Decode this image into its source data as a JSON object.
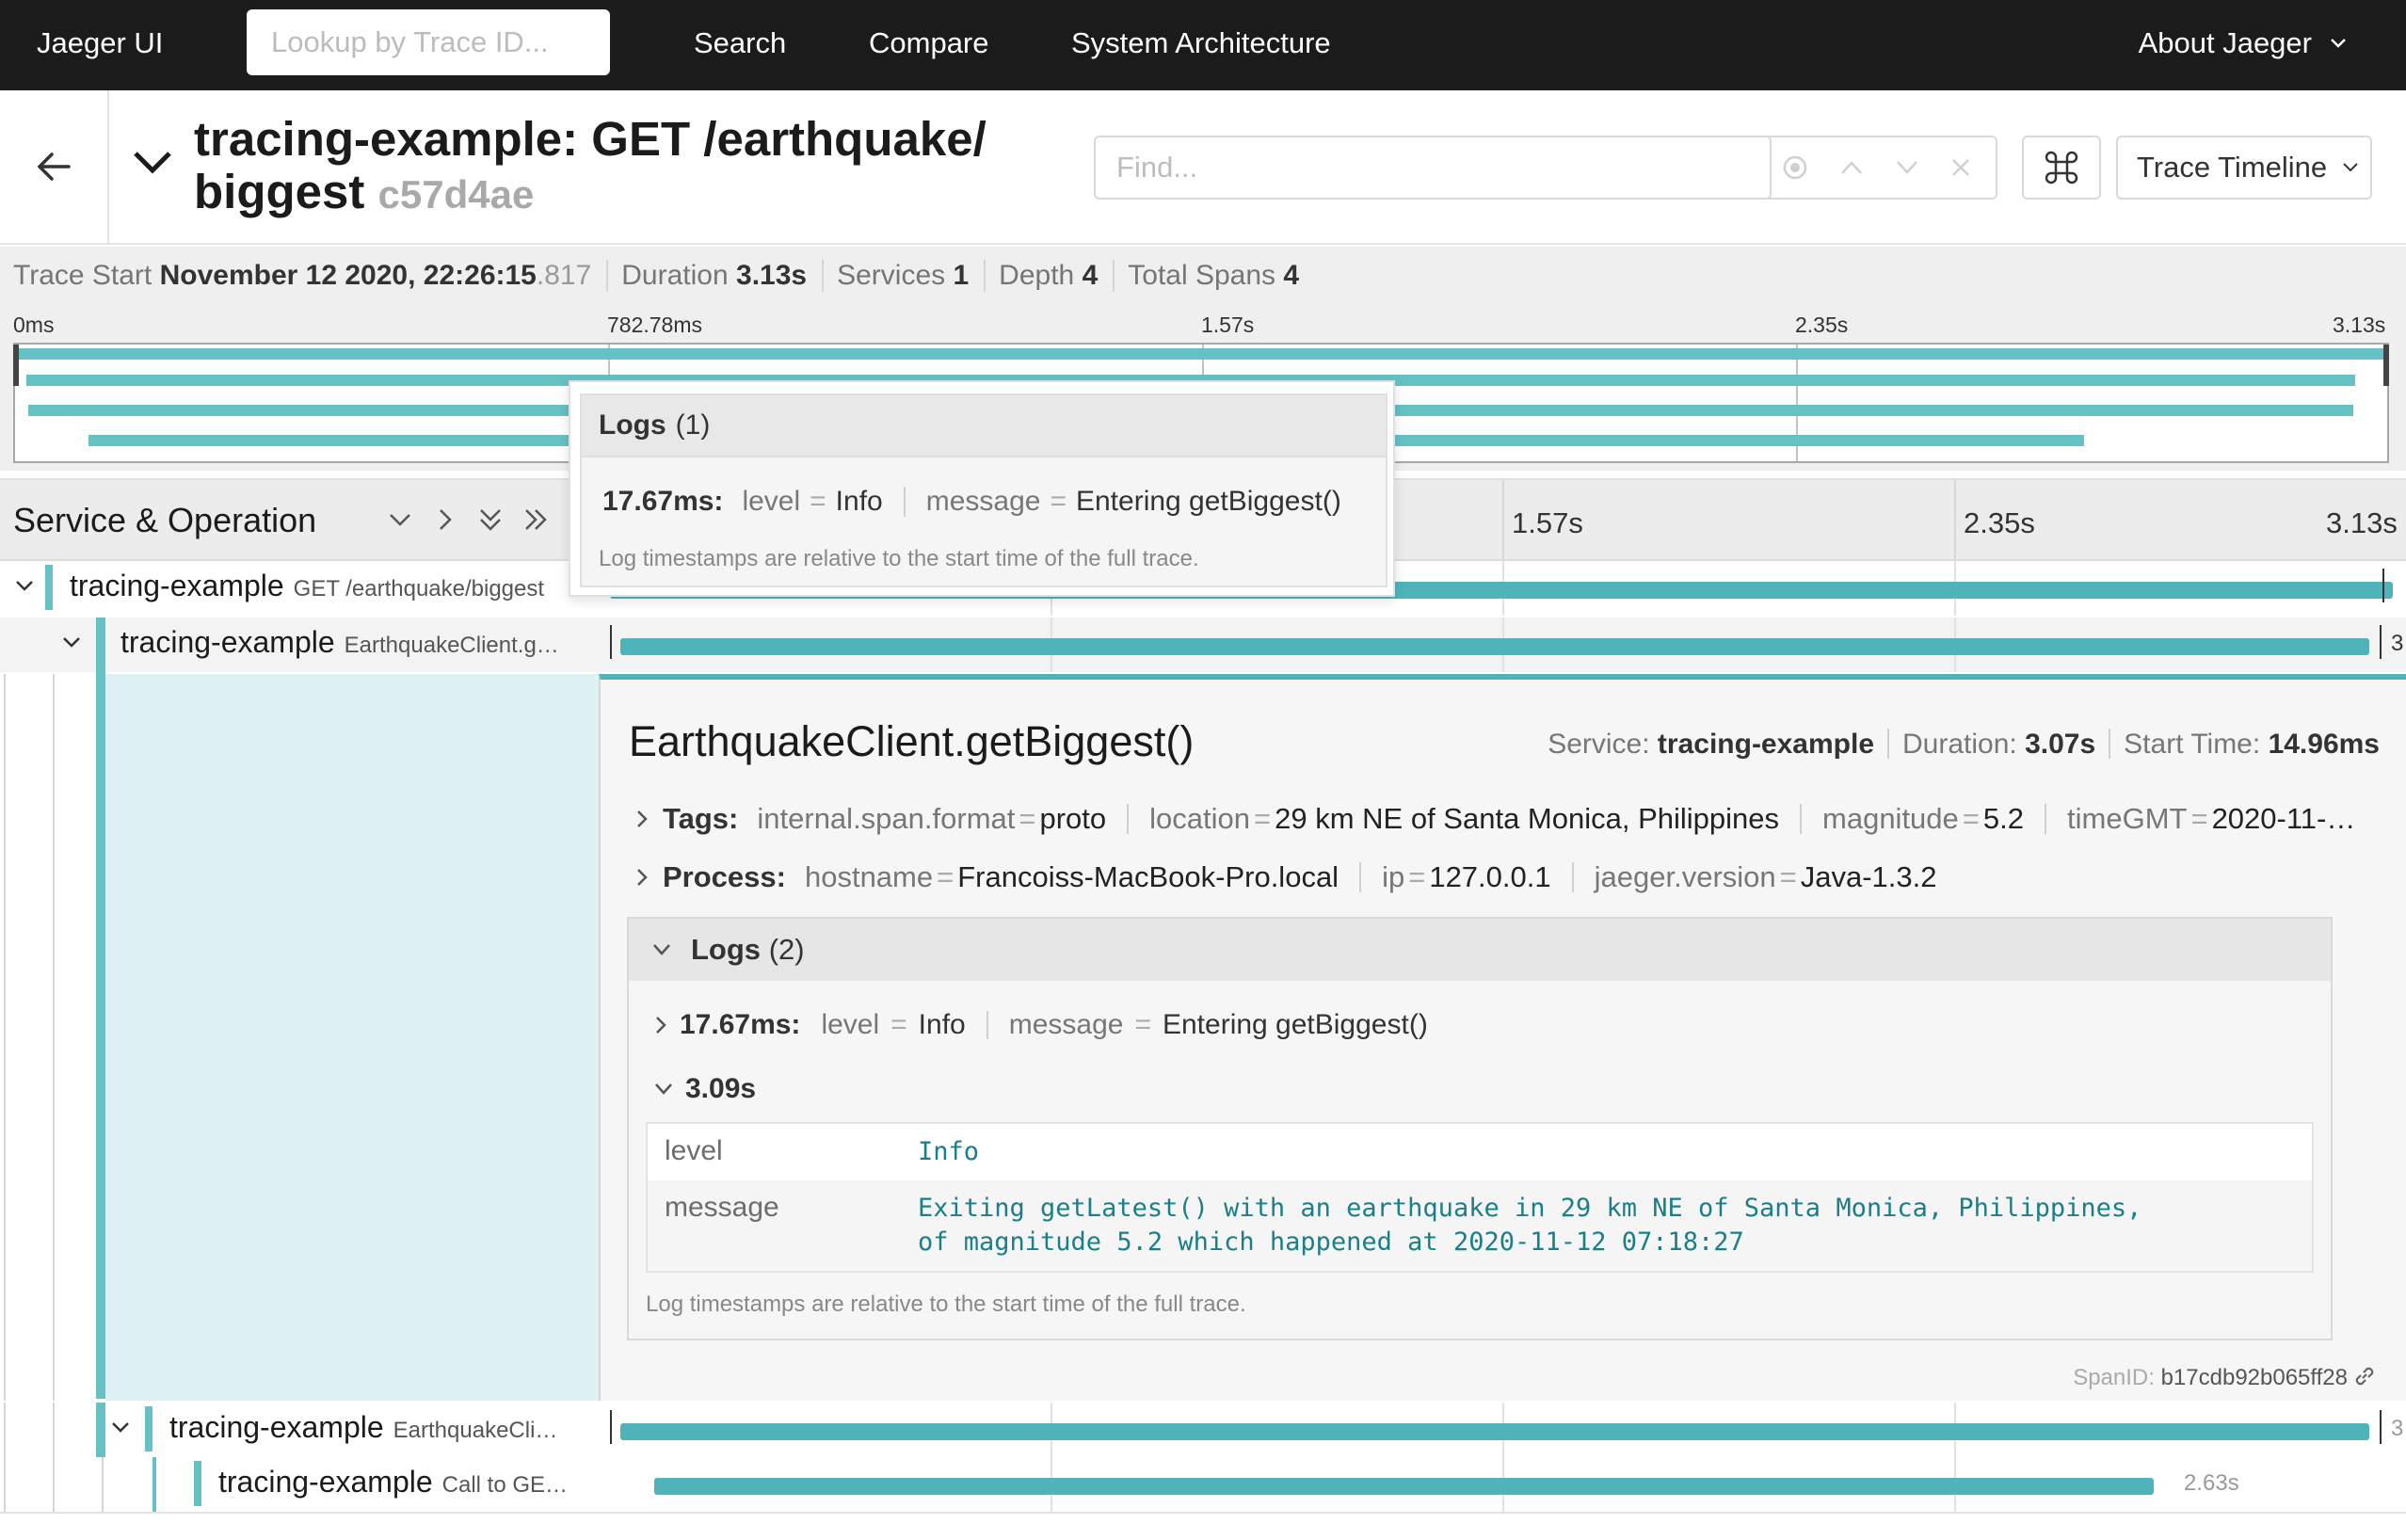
{
  "nav": {
    "brand": "Jaeger UI",
    "lookup_placeholder": "Lookup by Trace ID...",
    "links": [
      "Search",
      "Compare",
      "System Architecture"
    ],
    "about": "About Jaeger"
  },
  "header": {
    "title_line1": "tracing-example: GET /earthquake/",
    "title_line2": "biggest",
    "trace_id": "c57d4ae",
    "find_placeholder": "Find...",
    "view_mode": "Trace Timeline"
  },
  "summary": {
    "trace_start_label": "Trace Start",
    "trace_start_value": "November 12 2020, 22:26:15",
    "trace_start_ms": ".817",
    "duration_label": "Duration",
    "duration_value": "3.13s",
    "services_label": "Services",
    "services_value": "1",
    "depth_label": "Depth",
    "depth_value": "4",
    "total_spans_label": "Total Spans",
    "total_spans_value": "4"
  },
  "minimap": {
    "ticks": [
      "0ms",
      "782.78ms",
      "1.57s",
      "2.35s",
      "3.13s"
    ]
  },
  "timeline": {
    "column_title": "Service & Operation",
    "ticks": [
      "1.57s",
      "2.35s",
      "3.13s"
    ]
  },
  "spans": [
    {
      "service": "tracing-example",
      "operation": "GET /earthquake/biggest",
      "start_frac": 0.0,
      "end_frac": 1.0,
      "duration_label": ""
    },
    {
      "service": "tracing-example",
      "operation": "EarthquakeClient.g…",
      "start_frac": 0.006,
      "end_frac": 0.987,
      "duration_label": "3"
    },
    {
      "service": "tracing-example",
      "operation": "EarthquakeCli…",
      "start_frac": 0.006,
      "end_frac": 0.987,
      "duration_label": "3"
    },
    {
      "service": "tracing-example",
      "operation": "Call to GE…",
      "start_frac": 0.025,
      "end_frac": 0.866,
      "duration_label": "2.63s"
    }
  ],
  "detail": {
    "title": "EarthquakeClient.getBiggest()",
    "service_label": "Service:",
    "service_value": "tracing-example",
    "duration_label": "Duration:",
    "duration_value": "3.07s",
    "start_label": "Start Time:",
    "start_value": "14.96ms",
    "tags_label": "Tags:",
    "tags": [
      {
        "k": "internal.span.format",
        "v": "proto"
      },
      {
        "k": "location",
        "v": "29 km NE of Santa Monica, Philippines"
      },
      {
        "k": "magnitude",
        "v": "5.2"
      },
      {
        "k": "timeGMT",
        "v": "2020-11-…"
      }
    ],
    "process_label": "Process:",
    "process": [
      {
        "k": "hostname",
        "v": "Francoiss-MacBook-Pro.local"
      },
      {
        "k": "ip",
        "v": "127.0.0.1"
      },
      {
        "k": "jaeger.version",
        "v": "Java-1.3.2"
      }
    ],
    "logs_label": "Logs",
    "logs_count": "(2)",
    "log1_time": "17.67ms:",
    "log1_fields": [
      {
        "k": "level",
        "v": "Info"
      },
      {
        "k": "message",
        "v": "Entering getBiggest()"
      }
    ],
    "log2_time": "3.09s",
    "log2_rows": [
      {
        "k": "level",
        "v": "Info"
      },
      {
        "k": "message",
        "v": "Exiting getLatest() with an earthquake in 29 km NE of Santa Monica, Philippines,\nof magnitude 5.2 which happened at 2020-11-12 07:18:27"
      }
    ],
    "logs_note": "Log timestamps are relative to the start time of the full trace.",
    "spanid_label": "SpanID:",
    "spanid_value": "b17cdb92b065ff28"
  },
  "popover": {
    "title": "Logs",
    "count": "(1)",
    "time": "17.67ms:",
    "fields": [
      {
        "k": "level",
        "v": "Info"
      },
      {
        "k": "message",
        "v": "Entering getBiggest()"
      }
    ],
    "note": "Log timestamps are relative to the start time of the full trace."
  },
  "colors": {
    "nav_bg": "#1b1b1b",
    "span_bar": "#4fb4ba",
    "service_marker": "#65c1c4",
    "detail_fill": "#def1f3",
    "log_value": "#1a7f88"
  }
}
